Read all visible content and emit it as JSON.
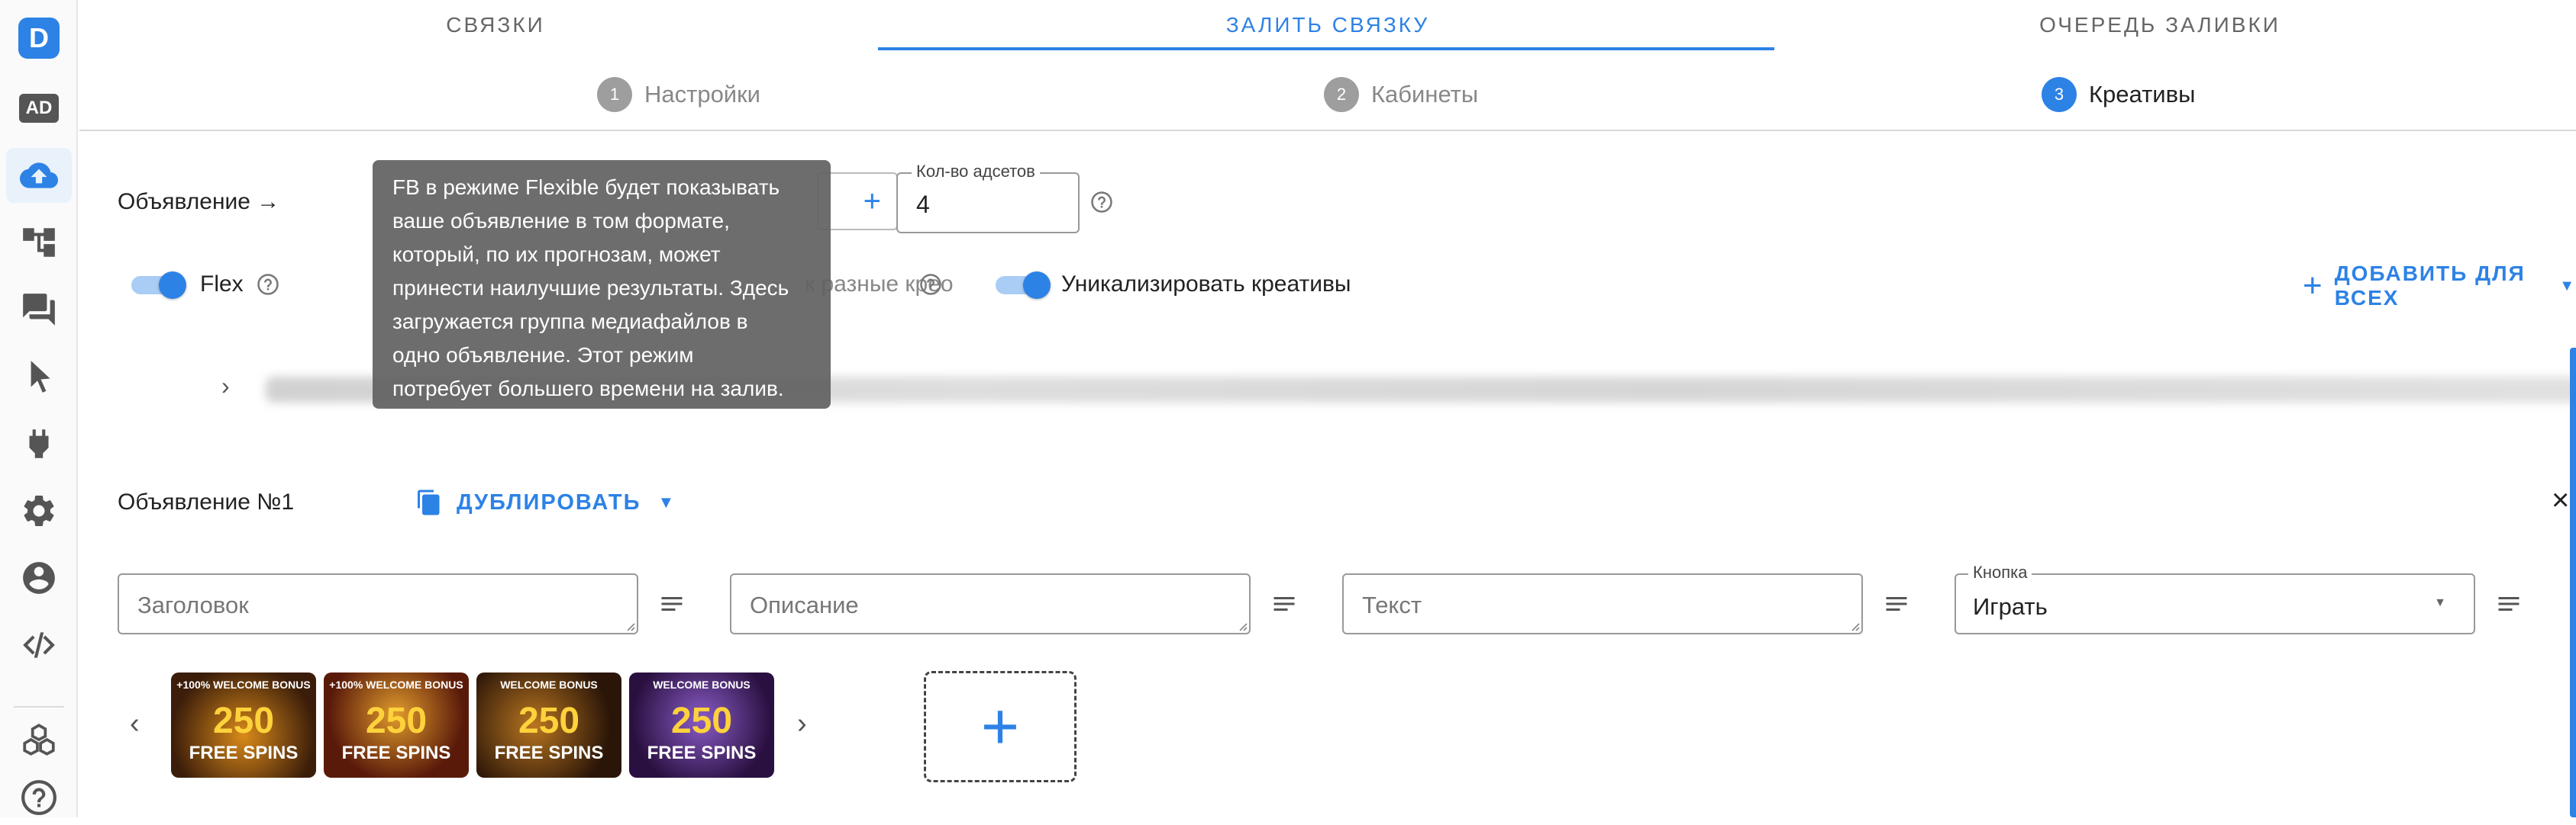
{
  "sidebar": {
    "logo_letter": "D",
    "ad_label": "AD",
    "items": [
      {
        "icon": "cloud-upload-icon",
        "active": true
      },
      {
        "icon": "hierarchy-icon"
      },
      {
        "icon": "chat-icon"
      },
      {
        "icon": "cursor-icon"
      },
      {
        "icon": "plug-icon"
      },
      {
        "icon": "gear-icon"
      },
      {
        "icon": "user-circle-icon"
      },
      {
        "icon": "code-icon"
      },
      {
        "icon": "cubes-icon"
      },
      {
        "icon": "help-icon"
      }
    ]
  },
  "tabs": [
    {
      "label": "СВЯЗКИ"
    },
    {
      "label": "ЗАЛИТЬ СВЯЗКУ",
      "active": true
    },
    {
      "label": "ОЧЕРЕДЬ ЗАЛИВКИ"
    }
  ],
  "steps": [
    {
      "num": "1",
      "label": "Настройки"
    },
    {
      "num": "2",
      "label": "Кабинеты"
    },
    {
      "num": "3",
      "label": "Креативы",
      "active": true
    }
  ],
  "ad_row": {
    "label": "Объявление →",
    "count_plus": "+",
    "adsets_label": "Кол-во адсетов",
    "adsets_value": "4"
  },
  "options": {
    "flex_label": "Flex",
    "diff_creo_label": "к разные крео",
    "unique_label": "Уникализировать креативы",
    "add_all_plus": "+",
    "add_all_label": "ДОБАВИТЬ ДЛЯ ВСЕХ"
  },
  "tooltip": {
    "lines": [
      "FB в режиме Flexible будет показывать",
      "ваше объявление в том формате,",
      "который, по их прогнозам, может",
      "принести наилучшие результаты. Здесь",
      "загружается группа медиафайлов в",
      "одно объявление. Этот режим",
      "потребует большего времени на залив."
    ]
  },
  "ad_block": {
    "title": "Объявление №1",
    "duplicate_label": "ДУБЛИРОВАТЬ",
    "close": "×",
    "headline_placeholder": "Заголовок",
    "description_placeholder": "Описание",
    "text_placeholder": "Текст",
    "button_legend": "Кнопка",
    "button_value": "Играть"
  },
  "media": {
    "prev": "‹",
    "next": "›",
    "add": "+",
    "thumbs": [
      {
        "top": "+100% WELCOME BONUS",
        "big": "250",
        "bottom": "FREE SPINS"
      },
      {
        "top": "+100% WELCOME BONUS",
        "big": "250",
        "bottom": "FREE SPINS"
      },
      {
        "top": "WELCOME BONUS",
        "big": "250",
        "bottom": "FREE SPINS"
      },
      {
        "top": "WELCOME BONUS",
        "big": "250",
        "bottom": "FREE SPINS"
      }
    ]
  },
  "colors": {
    "accent": "#2d82e6",
    "tooltip_bg": "#616161"
  }
}
